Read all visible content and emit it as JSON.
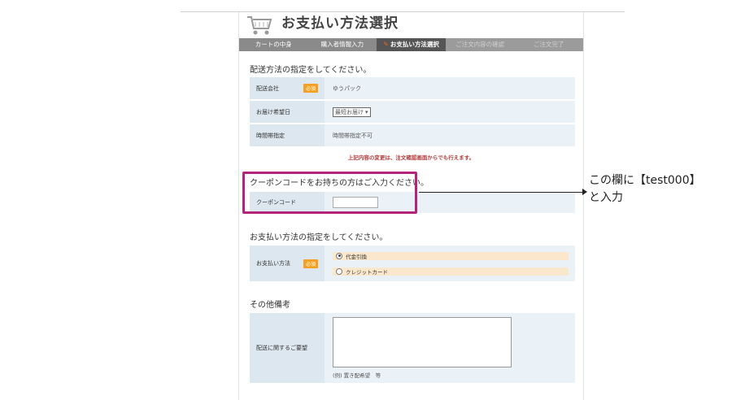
{
  "header": {
    "title": "お支払い方法選択",
    "cart_icon": "shopping-cart-icon"
  },
  "steps": [
    {
      "label": "カートの中身"
    },
    {
      "label": "購入者情報入力"
    },
    {
      "label": "お支払い方法選択"
    },
    {
      "label": "ご注文内容の確認"
    },
    {
      "label": "ご注文完了"
    }
  ],
  "shipping": {
    "title": "配送方法の指定をしてください。",
    "rows": [
      {
        "label": "配送会社",
        "required": "必須",
        "value": "ゆうパック"
      },
      {
        "label": "お届け希望日",
        "value": "最短お届け"
      },
      {
        "label": "時間帯指定",
        "value": "時間帯指定不可"
      }
    ],
    "note": "上記内容の変更は、注文確認画面からでも行えます。"
  },
  "coupon": {
    "title": "クーポンコードをお持ちの方はご入力ください。",
    "label": "クーポンコード",
    "value": ""
  },
  "payment": {
    "title": "お支払い方法の指定をしてください。",
    "label": "お支払い方法",
    "required": "必須",
    "options": [
      "代金引換",
      "クレジットカード"
    ],
    "selected": "代金引換"
  },
  "remarks": {
    "title": "その他備考",
    "label": "配送に関するご要望",
    "example": "(例) 置き配希望　等"
  },
  "callout": {
    "line1": "この欄に【test000】",
    "line2": "と入力"
  },
  "colors": {
    "highlight": "#b3257a",
    "required_badge": "#f5a020",
    "note_text": "#b23a3a"
  }
}
